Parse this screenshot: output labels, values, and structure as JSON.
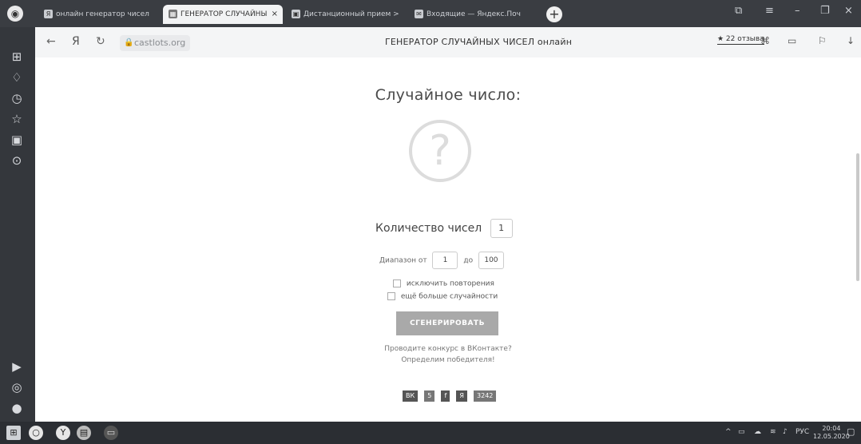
{
  "tabs": [
    {
      "label": "онлайн генератор чисел",
      "icon": "Я",
      "active": false
    },
    {
      "label": "ГЕНЕРАТОР СЛУЧАЙНЫ",
      "icon": "▦",
      "active": true,
      "close": "×"
    },
    {
      "label": "Дистанционный прием >",
      "icon": "▣",
      "active": false
    },
    {
      "label": "Входящие — Яндекс.Поч",
      "icon": "✉",
      "active": false
    }
  ],
  "address_bar": {
    "url": "castlots.org",
    "page_title": "ГЕНЕРАТОР СЛУЧАЙНЫХ ЧИСЕЛ онлайн",
    "reviews": "★ 22 отзыва",
    "yandex": "Я"
  },
  "page": {
    "heading": "Случайное число:",
    "result_symbol": "?",
    "count_label": "Количество чисел",
    "count_value": "1",
    "range_from_label": "Диапазон от",
    "range_from": "1",
    "range_to_label": "до",
    "range_to": "100",
    "option_exclude": "исключить повторения",
    "option_random": "ещё больше случайности",
    "generate_button": "СГЕНЕРИРОВАТЬ",
    "promo_line1": "Проводите конкурс в ВКонтакте?",
    "promo_line2": "Определим победителя!",
    "share": {
      "vk": "ВК",
      "vk_count": "5",
      "fb": "f",
      "ok": "Я",
      "ok_count": "3242"
    }
  },
  "taskbar": {
    "lang": "РУС",
    "time": "20:04",
    "date": "12.05.2020"
  }
}
